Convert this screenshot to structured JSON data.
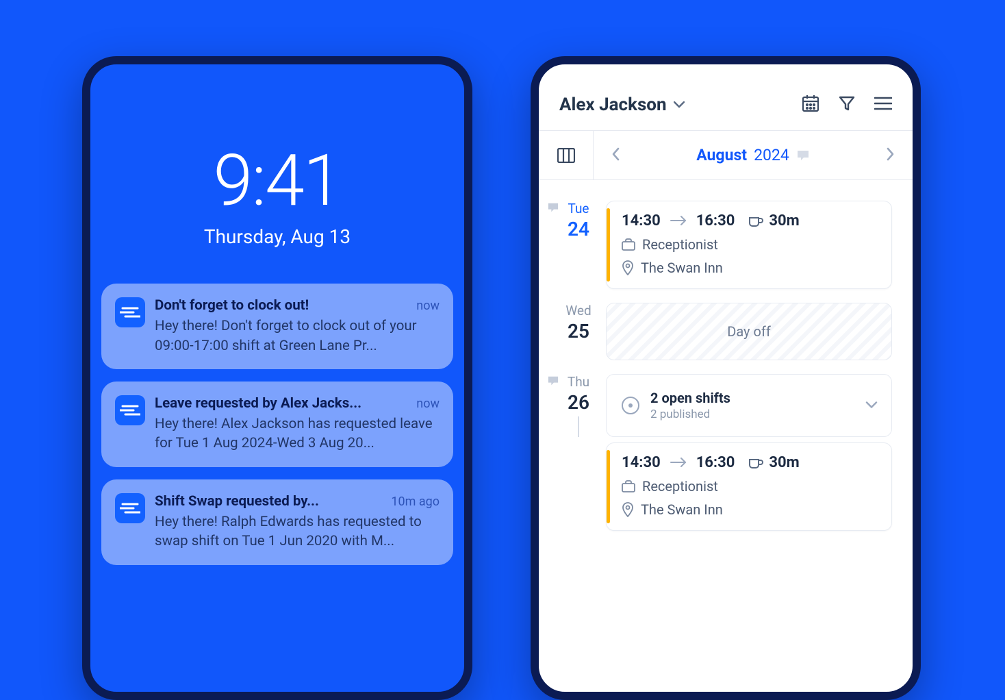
{
  "colors": {
    "bg": "#1157fb",
    "frame": "#0b1b53",
    "accent": "#1361ff",
    "shiftBar": "#ffb300"
  },
  "lock": {
    "time": "9:41",
    "date": "Thursday, Aug 13",
    "notifications": [
      {
        "title": "Don't forget to clock out!",
        "when": "now",
        "body": "Hey there! Don't forget to clock out of your 09:00-17:00 shift at Green Lane Pr..."
      },
      {
        "title": "Leave requested by Alex Jacks...",
        "when": "now",
        "body": "Hey there! Alex Jackson has requested leave for Tue 1 Aug 2024-Wed 3 Aug 20..."
      },
      {
        "title": "Shift Swap requested by...",
        "when": "10m ago",
        "body": "Hey there! Ralph Edwards has requested to swap shift on Tue 1 Jun 2020 with M..."
      }
    ]
  },
  "schedule": {
    "user": "Alex Jackson",
    "month": "August",
    "year": "2024",
    "days": [
      {
        "dow": "Tue",
        "num": "24",
        "active": true,
        "hasChat": true,
        "type": "shift",
        "start": "14:30",
        "end": "16:30",
        "break": "30m",
        "role": "Receptionist",
        "location": "The Swan Inn"
      },
      {
        "dow": "Wed",
        "num": "25",
        "active": false,
        "hasChat": false,
        "type": "dayoff",
        "label": "Day off"
      },
      {
        "dow": "Thu",
        "num": "26",
        "active": false,
        "hasChat": true,
        "type": "open",
        "openTitle": "2 open shifts",
        "openSub": "2 published",
        "followShift": {
          "start": "14:30",
          "end": "16:30",
          "break": "30m",
          "role": "Receptionist",
          "location": "The Swan Inn"
        }
      }
    ]
  }
}
